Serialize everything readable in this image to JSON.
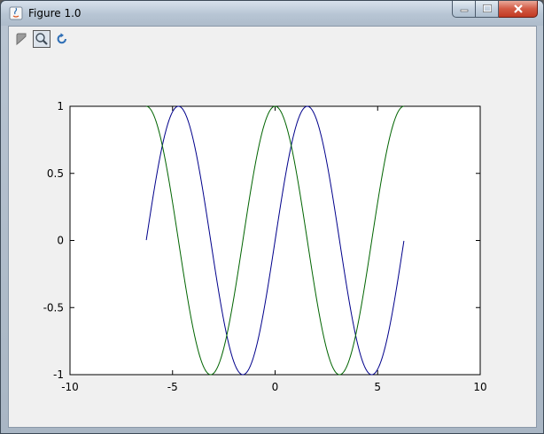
{
  "window": {
    "title": "Figure 1.0"
  },
  "toolbar": {
    "items": [
      {
        "icon": "pan-icon",
        "selected": false
      },
      {
        "icon": "zoom-icon",
        "selected": true
      },
      {
        "icon": "reset-view-icon",
        "selected": false
      }
    ]
  },
  "chart_data": {
    "type": "line",
    "xlim": [
      -10,
      10
    ],
    "ylim": [
      -1,
      1
    ],
    "xticks": [
      -10,
      -5,
      0,
      5,
      10
    ],
    "xtick_labels": [
      "-10",
      "-5",
      "0",
      "5",
      "10"
    ],
    "yticks": [
      -1,
      -0.5,
      0,
      0.5,
      1
    ],
    "ytick_labels": [
      "-1",
      "-0.5",
      "0",
      "0.5",
      "1"
    ],
    "grid": false,
    "series": [
      {
        "function": "sin(x)",
        "x_range": [
          -6.28,
          6.28
        ],
        "color": "#00008b"
      },
      {
        "function": "cos(x)",
        "x_range": [
          -6.28,
          6.28
        ],
        "color": "#006400"
      }
    ]
  }
}
